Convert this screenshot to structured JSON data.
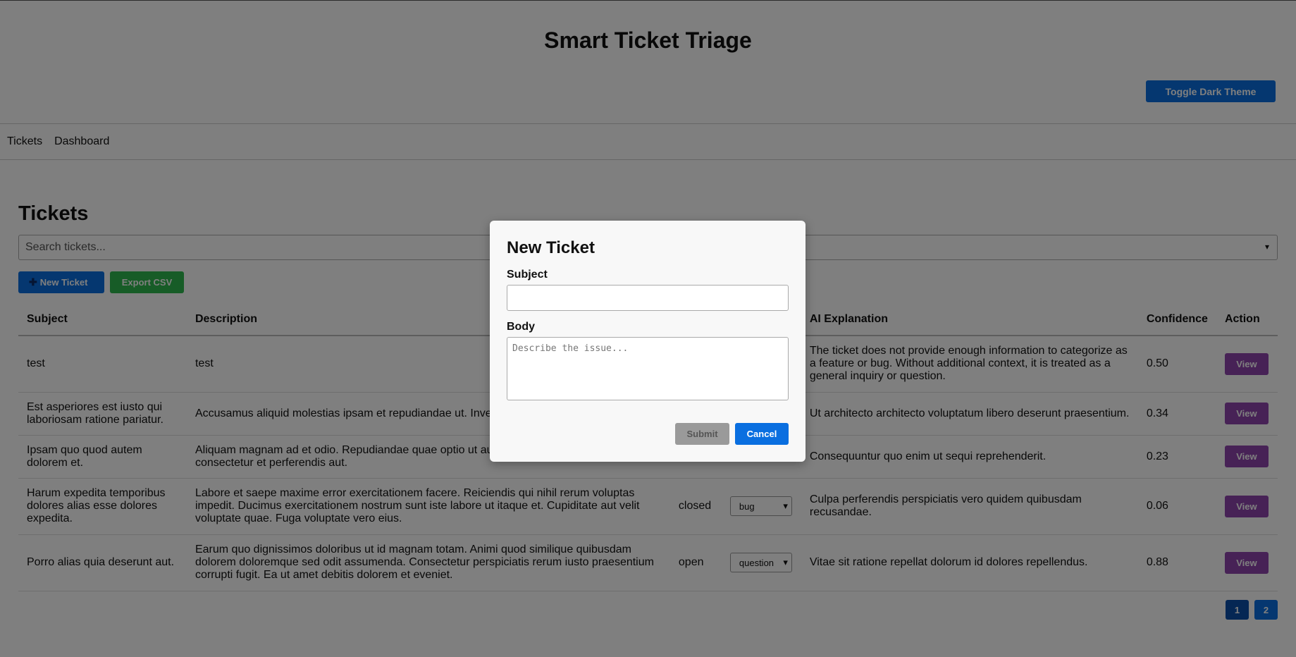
{
  "app": {
    "title": "Smart Ticket Triage",
    "theme_toggle": "Toggle Dark Theme"
  },
  "nav": {
    "tickets": "Tickets",
    "dashboard": "Dashboard"
  },
  "page": {
    "title": "Tickets"
  },
  "search": {
    "placeholder": "Search tickets..."
  },
  "toolbar": {
    "new_ticket_icon": "plus-icon",
    "new_ticket": "New Ticket",
    "export": "Export CSV"
  },
  "table": {
    "headers": {
      "subject": "Subject",
      "description": "Description",
      "ai_explanation": "AI Explanation",
      "confidence": "Confidence",
      "action": "Action"
    },
    "rows": [
      {
        "subject": "test",
        "description": "test",
        "status": "",
        "category": "",
        "ai_explanation": "The ticket does not provide enough information to categorize as a feature or bug. Without additional context, it is treated as a general inquiry or question.",
        "confidence": "0.50",
        "action": "View"
      },
      {
        "subject": "Est asperiores est iusto qui laboriosam ratione pariatur.",
        "description": "Accusamus aliquid molestias ipsam et repudiandae ut. Inve occaecati.",
        "status": "",
        "category": "",
        "ai_explanation": "Ut architecto architecto voluptatum libero deserunt praesentium.",
        "confidence": "0.34",
        "action": "View"
      },
      {
        "subject": "Ipsam quo quod autem dolorem et.",
        "description": "Aliquam magnam ad et odio. Repudiandae quae optio ut au beatae vero animi. Odio consectetur et perferendis aut.",
        "status": "",
        "category": "",
        "ai_explanation": "Consequuntur quo enim ut sequi reprehenderit.",
        "confidence": "0.23",
        "action": "View"
      },
      {
        "subject": "Harum expedita temporibus dolores alias esse dolores expedita.",
        "description": "Labore et saepe maxime error exercitationem facere. Reiciendis qui nihil rerum voluptas impedit. Ducimus exercitationem nostrum sunt iste labore ut itaque et. Cupiditate aut velit voluptate quae. Fuga voluptate vero eius.",
        "status": "closed",
        "category": "bug",
        "ai_explanation": "Culpa perferendis perspiciatis vero quidem quibusdam recusandae.",
        "confidence": "0.06",
        "action": "View"
      },
      {
        "subject": "Porro alias quia deserunt aut.",
        "description": "Earum quo dignissimos doloribus ut id magnam totam. Animi quod similique quibusdam dolorem doloremque sed odit assumenda. Consectetur perspiciatis rerum iusto praesentium corrupti fugit. Ea ut amet debitis dolorem et eveniet.",
        "status": "open",
        "category": "question",
        "ai_explanation": "Vitae sit ratione repellat dolorum id dolores repellendus.",
        "confidence": "0.88",
        "action": "View"
      }
    ]
  },
  "pagination": {
    "pages": [
      "1",
      "2"
    ],
    "current": "1"
  },
  "modal": {
    "title": "New Ticket",
    "subject_label": "Subject",
    "subject_value": "",
    "body_label": "Body",
    "body_placeholder": "Describe the issue...",
    "submit": "Submit",
    "cancel": "Cancel"
  }
}
